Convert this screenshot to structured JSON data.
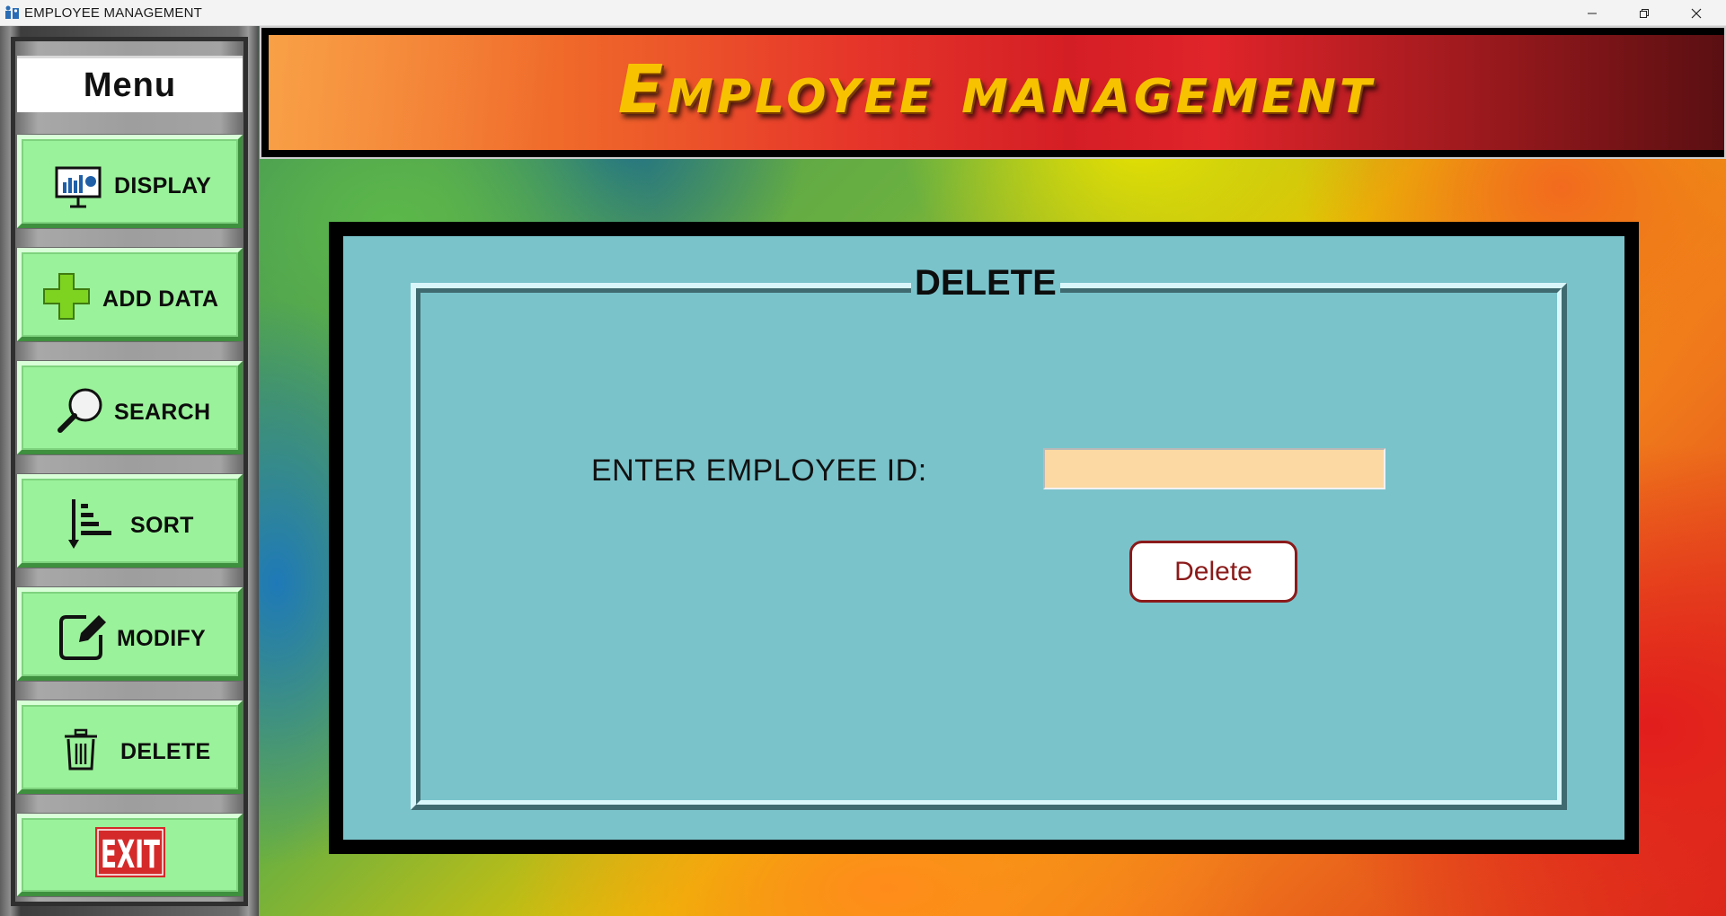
{
  "window": {
    "title": "EMPLOYEE MANAGEMENT",
    "controls": [
      "minimize",
      "restore",
      "close"
    ]
  },
  "banner": {
    "title": "Employee management"
  },
  "sidebar": {
    "header": "Menu",
    "items": [
      {
        "label": "DISPLAY",
        "icon": "monitor-chart-icon"
      },
      {
        "label": "ADD DATA",
        "icon": "plus-icon"
      },
      {
        "label": "SEARCH",
        "icon": "magnifier-icon"
      },
      {
        "label": "SORT",
        "icon": "sort-icon"
      },
      {
        "label": "MODIFY",
        "icon": "edit-icon"
      },
      {
        "label": "DELETE",
        "icon": "trash-icon"
      },
      {
        "label": "EXIT",
        "icon": "exit-sign-icon"
      }
    ]
  },
  "panel": {
    "legend": "DELETE",
    "id_label": "ENTER EMPLOYEE ID:",
    "id_value": "",
    "delete_button": "Delete"
  },
  "colors": {
    "nav_button": "#9af29a",
    "panel_bg": "#7ac3cb",
    "input_bg": "#fcd9a3",
    "delete_button_border": "#8b1a1a",
    "banner_title": "#f7c300",
    "exit_sign": "#d42a2a"
  }
}
